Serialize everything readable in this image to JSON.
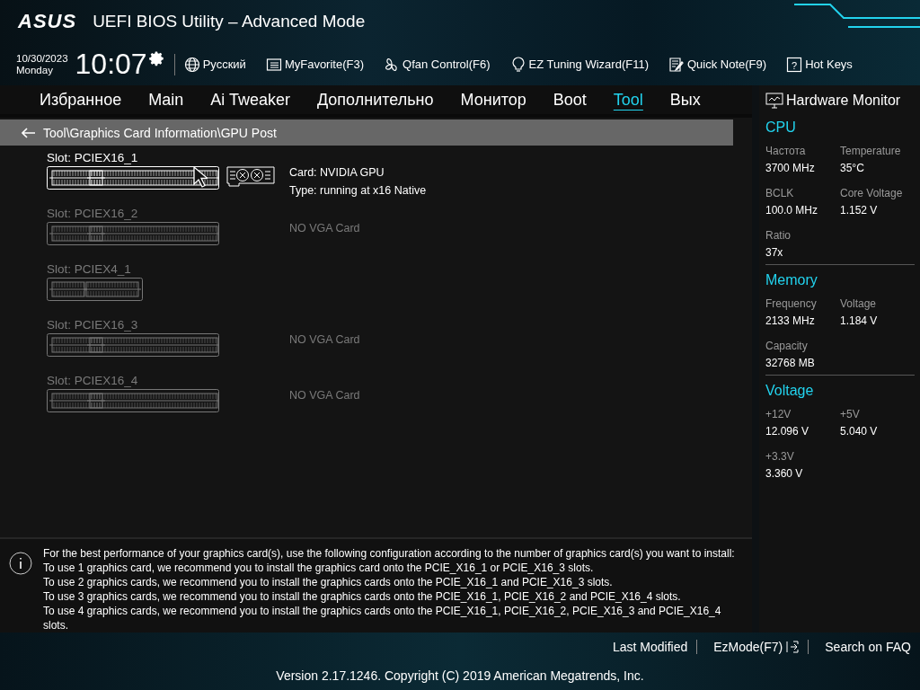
{
  "header": {
    "logo": "ASUS",
    "title": "UEFI BIOS Utility – Advanced Mode",
    "date": "10/30/2023",
    "day": "Monday",
    "time": "10:07",
    "tools": [
      {
        "kind": "globe",
        "label": "Русский"
      },
      {
        "kind": "favorite",
        "label": "MyFavorite(F3)"
      },
      {
        "kind": "fan",
        "label": "Qfan Control(F6)"
      },
      {
        "kind": "bulb",
        "label": "EZ Tuning Wizard(F11)"
      },
      {
        "kind": "note",
        "label": "Quick Note(F9)"
      },
      {
        "kind": "help",
        "glyph": "?",
        "label": "Hot Keys"
      }
    ]
  },
  "tabs": [
    {
      "label": "Избранное",
      "selected": false
    },
    {
      "label": "Main",
      "selected": false
    },
    {
      "label": "Ai Tweaker",
      "selected": false
    },
    {
      "label": "Дополнительно",
      "selected": false
    },
    {
      "label": "Монитор",
      "selected": false
    },
    {
      "label": "Boot",
      "selected": false
    },
    {
      "label": "Tool",
      "selected": true
    },
    {
      "label": "Вых",
      "selected": false
    }
  ],
  "breadcrumb": "Tool\\Graphics Card Information\\GPU Post",
  "slots": [
    {
      "label": "Slot: PCIEX16_1",
      "kind": "x16",
      "populated": true,
      "info": [
        "Card: NVIDIA GPU",
        "Type: running at x16 Native"
      ]
    },
    {
      "label": "Slot: PCIEX16_2",
      "kind": "x16",
      "populated": false,
      "info": [
        "NO VGA Card"
      ]
    },
    {
      "label": "Slot: PCIEX4_1",
      "kind": "x4",
      "populated": false
    },
    {
      "label": "Slot: PCIEX16_3",
      "kind": "x16",
      "populated": false,
      "info": [
        "NO VGA Card"
      ]
    },
    {
      "label": "Slot: PCIEX16_4",
      "kind": "x16",
      "populated": false,
      "info": [
        "NO VGA Card"
      ]
    }
  ],
  "help_lines": [
    "For the best performance of your graphics card(s), use the following configuration according to the number of graphics card(s) you want to install:",
    "To use 1 graphics card, we recommend you to install  the graphics card onto the PCIE_X16_1 or PCIE_X16_3 slots.",
    "To use 2 graphics cards, we recommend you to install the graphics cards onto the PCIE_X16_1 and PCIE_X16_3 slots.",
    "To use 3 graphics cards, we recommend you to install the graphics cards onto the PCIE_X16_1, PCIE_X16_2 and PCIE_X16_4 slots.",
    "To use 4 graphics cards, we recommend you to install the graphics cards onto the PCIE_X16_1, PCIE_X16_2, PCIE_X16_3 and PCIE_X16_4 slots."
  ],
  "hardware_monitor": {
    "title": "Hardware Monitor",
    "sections": [
      {
        "title": "CPU",
        "items": [
          {
            "label": "Частота",
            "value": "3700 MHz"
          },
          {
            "label": "Temperature",
            "value": "35°C"
          },
          {
            "label": "BCLK",
            "value": "100.0 MHz"
          },
          {
            "label": "Core Voltage",
            "value": "1.152 V"
          },
          {
            "label": "Ratio",
            "value": "37x"
          }
        ]
      },
      {
        "title": "Memory",
        "items": [
          {
            "label": "Frequency",
            "value": "2133 MHz"
          },
          {
            "label": "Voltage",
            "value": "1.184 V"
          },
          {
            "label": "Capacity",
            "value": "32768 MB"
          }
        ]
      },
      {
        "title": "Voltage",
        "items": [
          {
            "label": "+12V",
            "value": "12.096 V"
          },
          {
            "label": "+5V",
            "value": "5.040 V"
          },
          {
            "label": "+3.3V",
            "value": "3.360 V"
          }
        ]
      }
    ]
  },
  "footer": {
    "links": [
      {
        "kind": "text",
        "label": "Last Modified"
      },
      {
        "kind": "exit",
        "label": "EzMode(F7)"
      },
      {
        "kind": "text",
        "label": "Search on FAQ"
      }
    ],
    "copyright": "Version 2.17.1246. Copyright (C) 2019 American Megatrends, Inc."
  }
}
